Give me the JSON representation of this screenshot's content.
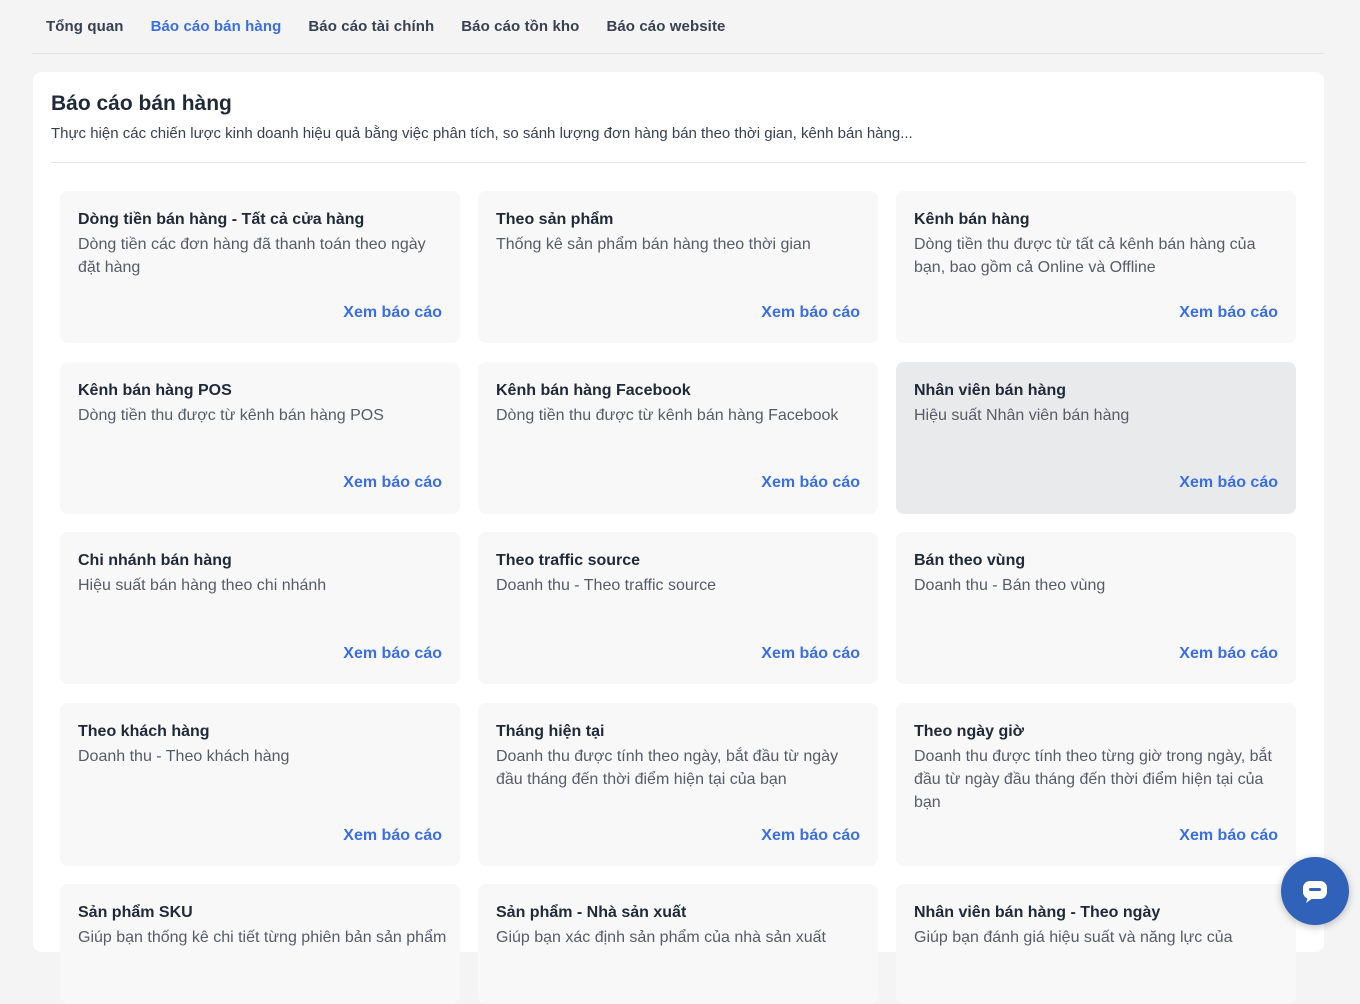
{
  "tabs": [
    {
      "label": "Tổng quan",
      "active": false
    },
    {
      "label": "Báo cáo bán hàng",
      "active": true
    },
    {
      "label": "Báo cáo tài chính",
      "active": false
    },
    {
      "label": "Báo cáo tồn kho",
      "active": false
    },
    {
      "label": "Báo cáo website",
      "active": false
    }
  ],
  "page": {
    "title": "Báo cáo bán hàng",
    "description": "Thực hiện các chiến lược kinh doanh hiệu quả bằng việc phân tích, so sánh lượng đơn hàng bán theo thời gian, kênh bán hàng..."
  },
  "link_label": "Xem báo cáo",
  "cards": [
    {
      "title": "Dòng tiền bán hàng - Tất cả cửa hàng",
      "description": "Dòng tiền các đơn hàng đã thanh toán theo ngày đặt hàng"
    },
    {
      "title": "Theo sản phẩm",
      "description": "Thống kê sản phẩm bán hàng theo thời gian"
    },
    {
      "title": "Kênh bán hàng",
      "description": "Dòng tiền thu được từ tất cả kênh bán hàng của bạn, bao gồm cả Online và Offline"
    },
    {
      "title": "Kênh bán hàng POS",
      "description": "Dòng tiền thu được từ kênh bán hàng POS"
    },
    {
      "title": "Kênh bán hàng Facebook",
      "description": "Dòng tiền thu được từ kênh bán hàng Facebook"
    },
    {
      "title": "Nhân viên bán hàng",
      "description": "Hiệu suất Nhân viên bán hàng",
      "hovered": true
    },
    {
      "title": "Chi nhánh bán hàng",
      "description": "Hiệu suất bán hàng theo chi nhánh"
    },
    {
      "title": "Theo traffic source",
      "description": "Doanh thu - Theo traffic source"
    },
    {
      "title": "Bán theo vùng",
      "description": "Doanh thu - Bán theo vùng"
    },
    {
      "title": "Theo khách hàng",
      "description": "Doanh thu - Theo khách hàng"
    },
    {
      "title": "Tháng hiện tại",
      "description": "Doanh thu được tính theo ngày, bắt đầu từ ngày đầu tháng đến thời điểm hiện tại của bạn"
    },
    {
      "title": "Theo ngày giờ",
      "description": "Doanh thu được tính theo từng giờ trong ngày, bắt đầu từ ngày đầu tháng đến thời điểm hiện tại của bạn"
    },
    {
      "title": "Sản phẩm SKU",
      "description": "Giúp bạn thống kê chi tiết từng phiên bản sản phẩm"
    },
    {
      "title": "Sản phẩm - Nhà sản xuất",
      "description": "Giúp bạn xác định sản phẩm của nhà sản xuất"
    },
    {
      "title": "Nhân viên bán hàng - Theo ngày",
      "description": "Giúp bạn đánh giá hiệu suất và năng lực của"
    }
  ],
  "colors": {
    "accent": "#3b6ee0",
    "chat_button": "#2f62b8",
    "hover_card": "#e9eaec"
  },
  "icons": {
    "chat": "chat-bubble-icon"
  }
}
